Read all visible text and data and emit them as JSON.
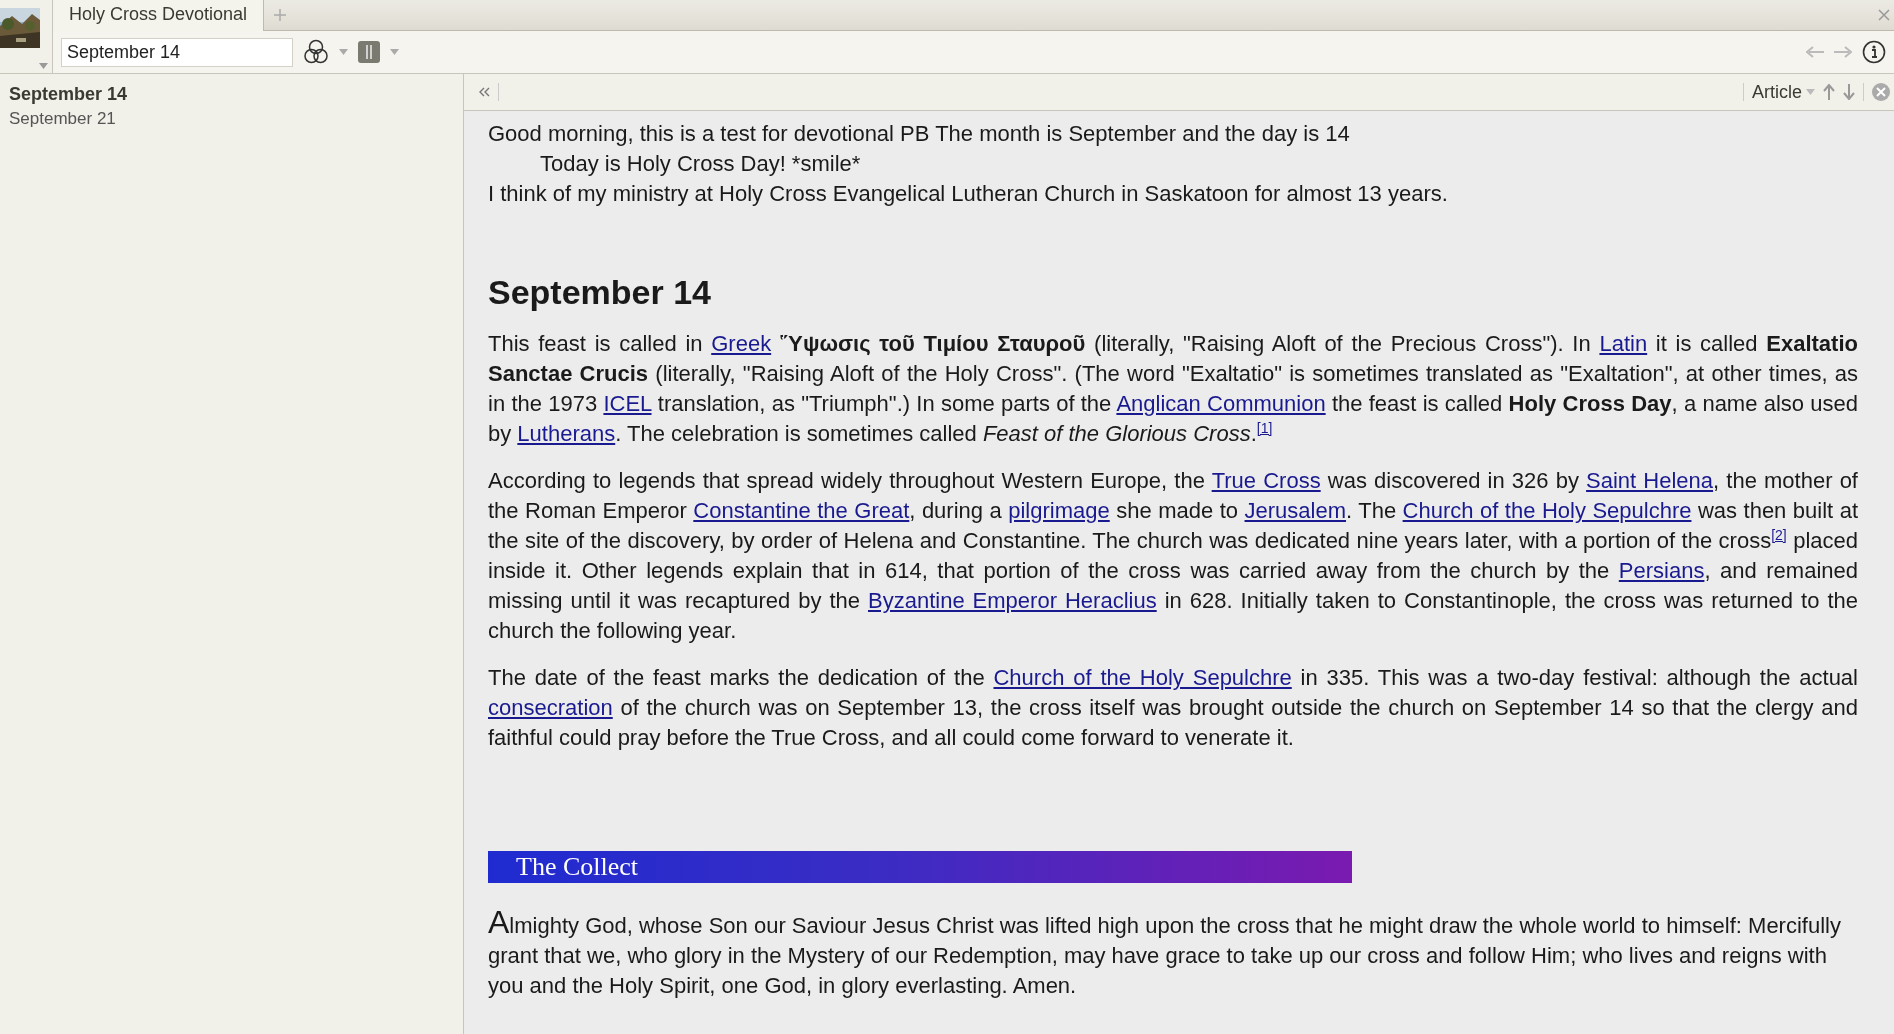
{
  "tab": {
    "title": "Holy Cross Devotional"
  },
  "toolbar": {
    "reference": "September 14"
  },
  "sidebar": {
    "items": [
      {
        "label": "September 14",
        "selected": true
      },
      {
        "label": "September 21",
        "selected": false
      }
    ]
  },
  "content_toolbar": {
    "view": "Article"
  },
  "intro": [
    "Good morning, this is a test for devotional PB The month is September and the day is 14",
    "Today is Holy Cross Day!  *smile*",
    "I think of my ministry at Holy Cross Evangelical Lutheran Church in Saskatoon for almost 13 years."
  ],
  "heading": "September 14",
  "paragraphs": [
    [
      {
        "kind": "text",
        "text": "This feast is called in "
      },
      {
        "kind": "link",
        "text": "Greek"
      },
      {
        "kind": "bold",
        "text": " Ὕψωσις τοῦ Τιμίου Σταυροῦ"
      },
      {
        "kind": "text",
        "text": " (literally, \"Raising Aloft of the Precious Cross\"). In "
      },
      {
        "kind": "link",
        "text": "Latin"
      },
      {
        "kind": "text",
        "text": " it is called "
      },
      {
        "kind": "bold",
        "text": "Exaltatio Sanctae Crucis"
      },
      {
        "kind": "text",
        "text": " (literally, \"Raising Aloft of the Holy Cross\". (The word \"Exaltatio\" is sometimes translated as \"Exaltation\", at other times, as in the 1973 "
      },
      {
        "kind": "link",
        "text": "ICEL"
      },
      {
        "kind": "text",
        "text": " translation, as \"Triumph\".) In some parts of the "
      },
      {
        "kind": "link",
        "text": "Anglican Communion"
      },
      {
        "kind": "text",
        "text": " the feast is called "
      },
      {
        "kind": "bold",
        "text": "Holy Cross Day"
      },
      {
        "kind": "text",
        "text": ", a name also used by "
      },
      {
        "kind": "link",
        "text": "Lutherans"
      },
      {
        "kind": "text",
        "text": ". The celebration is sometimes called "
      },
      {
        "kind": "italic",
        "text": "Feast of the Glorious Cross"
      },
      {
        "kind": "text",
        "text": "."
      },
      {
        "kind": "sup",
        "text": "[1]"
      }
    ],
    [
      {
        "kind": "text",
        "text": "According to legends that spread widely throughout Western Europe, the "
      },
      {
        "kind": "link",
        "text": "True Cross"
      },
      {
        "kind": "text",
        "text": " was discovered in 326 by "
      },
      {
        "kind": "link",
        "text": "Saint Helena"
      },
      {
        "kind": "text",
        "text": ", the mother of the Roman Emperor "
      },
      {
        "kind": "link",
        "text": "Constantine the Great"
      },
      {
        "kind": "text",
        "text": ", during a "
      },
      {
        "kind": "link",
        "text": "pilgrimage"
      },
      {
        "kind": "text",
        "text": " she made to "
      },
      {
        "kind": "link",
        "text": "Jerusalem"
      },
      {
        "kind": "text",
        "text": ". The "
      },
      {
        "kind": "link",
        "text": "Church of the Holy Sepulchre"
      },
      {
        "kind": "text",
        "text": " was then built at the site of the discovery, by order of Helena and Constantine. The church was dedicated nine years later, with a portion of the cross"
      },
      {
        "kind": "sup",
        "text": "[2]"
      },
      {
        "kind": "text",
        "text": " placed inside it. Other legends explain that in 614, that portion of the cross was carried away from the church by the "
      },
      {
        "kind": "link",
        "text": "Persians"
      },
      {
        "kind": "text",
        "text": ", and remained missing until it was recaptured by the "
      },
      {
        "kind": "link",
        "text": "Byzantine Emperor Heraclius"
      },
      {
        "kind": "text",
        "text": " in 628. Initially taken to Constantinople, the cross was returned to the church the following year."
      }
    ],
    [
      {
        "kind": "text",
        "text": "The date of the feast marks the dedication of the "
      },
      {
        "kind": "link",
        "text": "Church of the Holy Sepulchre"
      },
      {
        "kind": "text",
        "text": " in 335. This was a two-day festival: although the actual "
      },
      {
        "kind": "link",
        "text": "consecration"
      },
      {
        "kind": "text",
        "text": " of the church was on September 13, the cross itself was brought outside the church on September 14 so that the clergy and faithful could pray before the True Cross, and all could come forward to venerate it."
      }
    ]
  ],
  "collect": {
    "title": "The Collect",
    "text": "Almighty God, whose Son our Saviour Jesus Christ was lifted high upon the cross that he might draw the whole world to himself: Mercifully grant that we, who glory in the Mystery of our Redemption, may have grace to take up our cross and follow Him; who lives and reigns with you and the Holy Spirit, one God, in glory everlasting. Amen."
  }
}
